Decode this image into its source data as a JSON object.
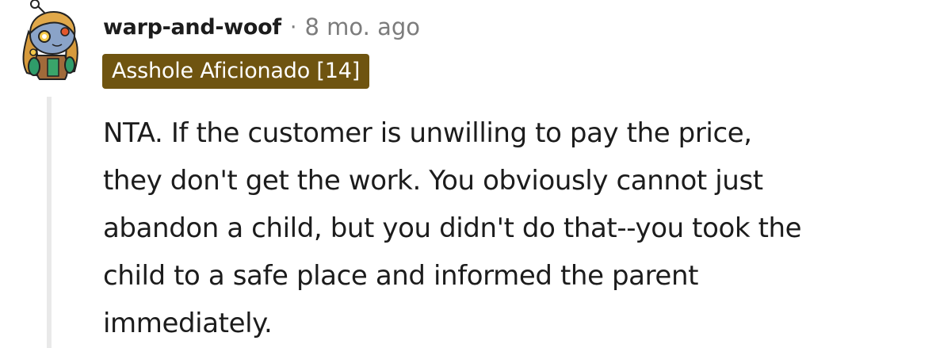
{
  "comment": {
    "author": "warp-and-woof",
    "separator": "·",
    "timestamp": "8 mo. ago",
    "flair": {
      "text": "Asshole Aficionado [14]",
      "background_color": "#6f5410",
      "text_color": "#ffffff"
    },
    "body_lines": [
      "NTA. If the customer is unwilling to pay the price,",
      "they don't get the work. You obviously cannot just",
      "abandon a child, but you didn't do that--you took the",
      "child to a safe place and informed the parent",
      "immediately."
    ]
  },
  "avatar": {
    "icon": "snoo-avatar-icon"
  },
  "thread_line_color": "#e9e9e9"
}
